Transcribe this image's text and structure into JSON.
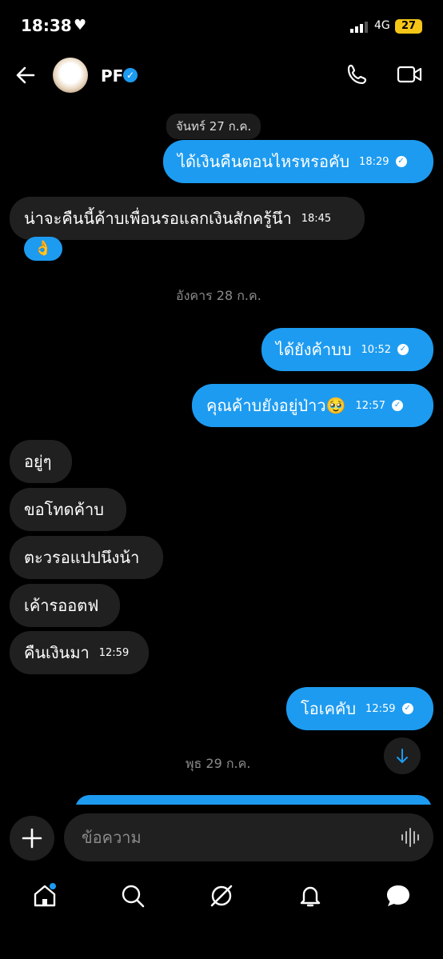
{
  "status": {
    "time": "18:38",
    "network": "4G",
    "battery": "27"
  },
  "header": {
    "name": "PF",
    "verified": "✓"
  },
  "messages": {
    "date1": "จันทร์ 27 ก.ค.",
    "m1": {
      "text": "ได้เงินคืนตอนไหรหรอคับ",
      "time": "18:29"
    },
    "m2": {
      "text": "น่าจะคืนนี้ค้าบเพื่อนรอแลกเงินสักครู้นึา",
      "time": "18:45",
      "reaction": "👌"
    },
    "date2": "อังคาร 28 ก.ค.",
    "m3": {
      "text": "ได้ยังค้าบบ",
      "time": "10:52"
    },
    "m4": {
      "text": "คุณค้าบยังอยู่ป่าว🥹",
      "time": "12:57"
    },
    "m5": {
      "text": "อยู่ๆ"
    },
    "m6": {
      "text": "ขอโทดค้าบ"
    },
    "m7": {
      "text": "ตะวรอแปปนึงน้า"
    },
    "m8": {
      "text": "เค้ารออตฟ"
    },
    "m9": {
      "text": "คืนเงินมา",
      "time": "12:59"
    },
    "m10": {
      "text": "โอเคคับ",
      "time": "12:59"
    },
    "date3": "พุธ 29 ก.ค."
  },
  "composer": {
    "placeholder": "ข้อความ"
  },
  "colors": {
    "accent": "#1d9bf0",
    "bubble_in": "#202020",
    "background": "#000000"
  },
  "icons": [
    "back-arrow-icon",
    "verified-badge-icon",
    "phone-icon",
    "video-icon",
    "scroll-down-icon",
    "plus-icon",
    "voice-wave-icon",
    "home-icon",
    "search-icon",
    "grok-icon",
    "bell-icon",
    "messages-icon"
  ]
}
